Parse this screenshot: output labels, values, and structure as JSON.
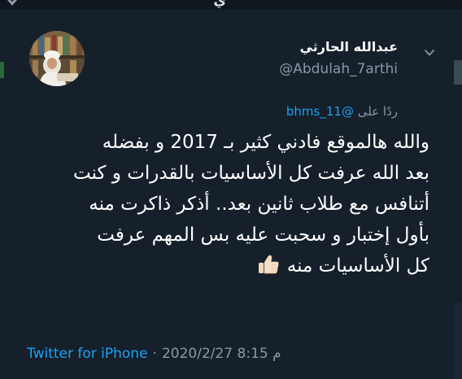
{
  "header_strip": {
    "partial_title": "ي"
  },
  "tweet": {
    "display_name": "عبدالله الحارثي",
    "username": "@Abdulah_7arthi",
    "reply_prefix": "ردًا على",
    "reply_to": "@bhms_11",
    "lines": [
      "والله هالموقع فادني كثير بـ 2017 و بفضله",
      "بعد الله عرفت كل الأساسيات بالقدرات و كنت",
      "أتنافس مع طلاب ثانين بعد.. أذكر ذاكرت منه",
      "بأول إختبار و سحبت عليه بس المهم عرفت",
      "كل الأساسيات منه"
    ],
    "emoji": "thumbs-up-light-skin-tone",
    "source": "Twitter for iPhone",
    "separator": "·",
    "date": "2020/2/27",
    "time": "م 8:15"
  },
  "colors": {
    "background": "#15202b",
    "accent": "#1da1f2",
    "secondary_text": "#8899a6",
    "primary_text": "#ffffff"
  },
  "icons": {
    "more_menu": "chevron-down-icon",
    "top_back": "bird-icon"
  }
}
